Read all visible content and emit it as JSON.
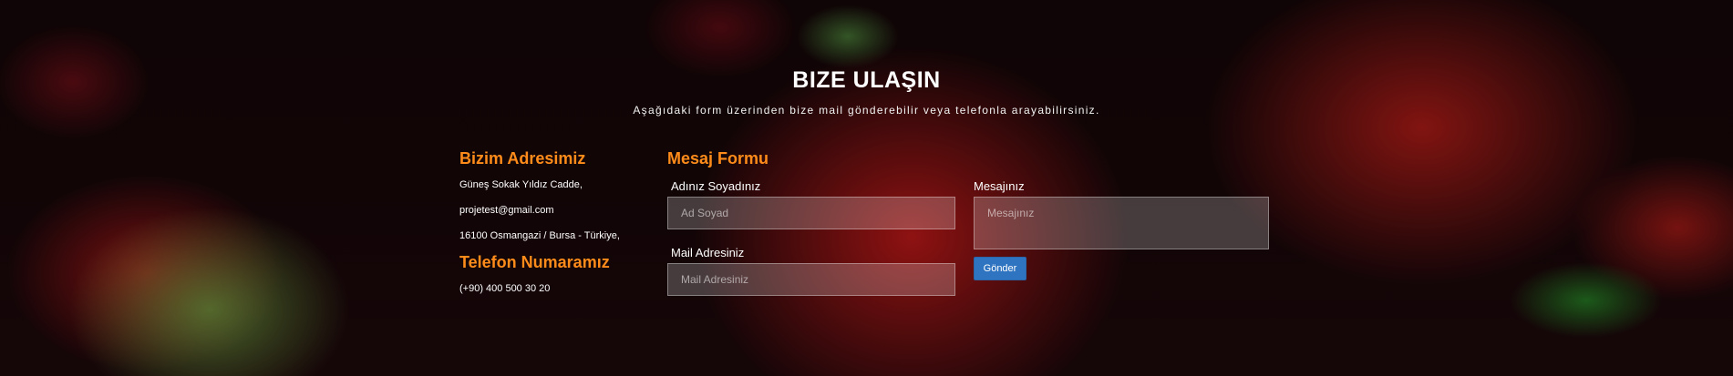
{
  "header": {
    "title": "BIZE ULAŞIN",
    "subtitle": "Aşağıdaki form üzerinden bize mail gönderebilir veya telefonla arayabilirsiniz."
  },
  "address": {
    "heading": "Bizim Adresimiz",
    "lines": [
      "Güneş Sokak Yıldız Cadde,",
      "projetest@gmail.com",
      "16100 Osmangazi / Bursa - Türkiye,"
    ]
  },
  "phone": {
    "heading": "Telefon Numaramız",
    "number": "(+90) 400 500 30 20"
  },
  "form": {
    "heading": "Mesaj Formu",
    "name_label": "Adınız Soyadınız",
    "name_placeholder": "Ad Soyad",
    "email_label": "Mail Adresiniz",
    "email_placeholder": "Mail Adresiniz",
    "message_label": "Mesajınız",
    "message_placeholder": "Mesajınız",
    "submit_label": "Gönder"
  },
  "colors": {
    "accent": "#ff8c1a",
    "button": "#2f74c0"
  }
}
